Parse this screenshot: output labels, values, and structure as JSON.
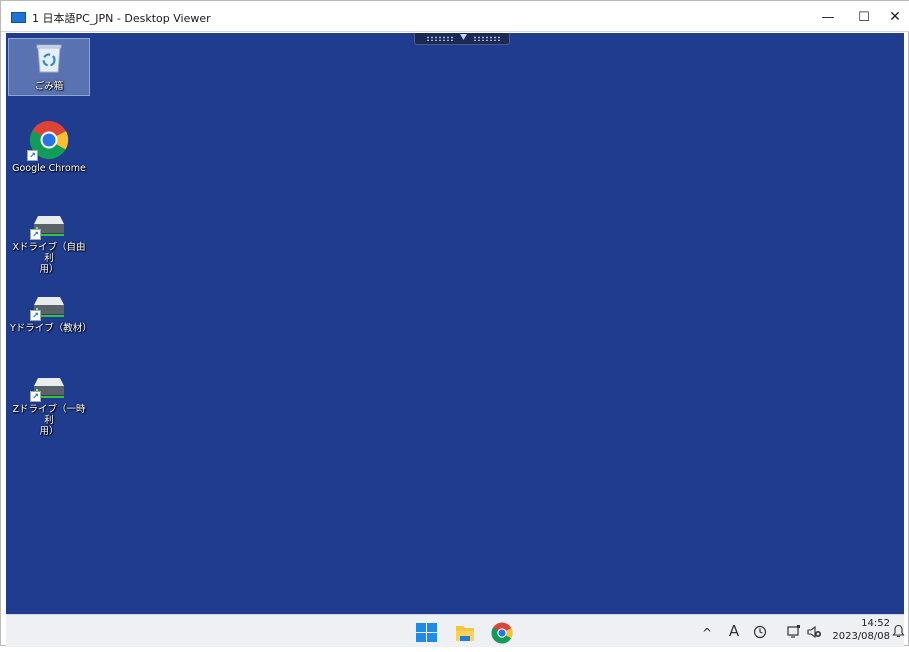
{
  "window": {
    "title": "1 日本語PC_JPN - Desktop Viewer",
    "controls": {
      "minimize": "—",
      "maximize": "☐",
      "close": "✕"
    }
  },
  "connection_bar": {
    "icon": "pin-arrow-icon"
  },
  "desktop": {
    "background": "#1f3c8f",
    "icons": [
      {
        "name": "recycle-bin",
        "label": "ごみ箱",
        "icon": "recycle-bin-icon",
        "selected": true
      },
      {
        "name": "google-chrome",
        "label": "Google Chrome",
        "icon": "chrome-icon",
        "shortcut": true
      },
      {
        "name": "x-drive",
        "label_line1": "Xドライブ（自由利",
        "label_line2": "用）",
        "icon": "network-drive-icon",
        "shortcut": true
      },
      {
        "name": "y-drive",
        "label": "Yドライブ（教材）",
        "icon": "network-drive-icon",
        "shortcut": true
      },
      {
        "name": "z-drive",
        "label_line1": "Zドライブ（一時利",
        "label_line2": "用）",
        "icon": "network-drive-icon",
        "shortcut": true
      }
    ]
  },
  "taskbar": {
    "apps": [
      {
        "name": "start",
        "icon": "windows-start-icon"
      },
      {
        "name": "file-explorer",
        "icon": "folder-icon"
      },
      {
        "name": "google-chrome",
        "icon": "chrome-icon"
      }
    ],
    "tray": {
      "chevron": "^",
      "ime": "A",
      "time": "14:52",
      "date": "2023/08/08"
    }
  }
}
